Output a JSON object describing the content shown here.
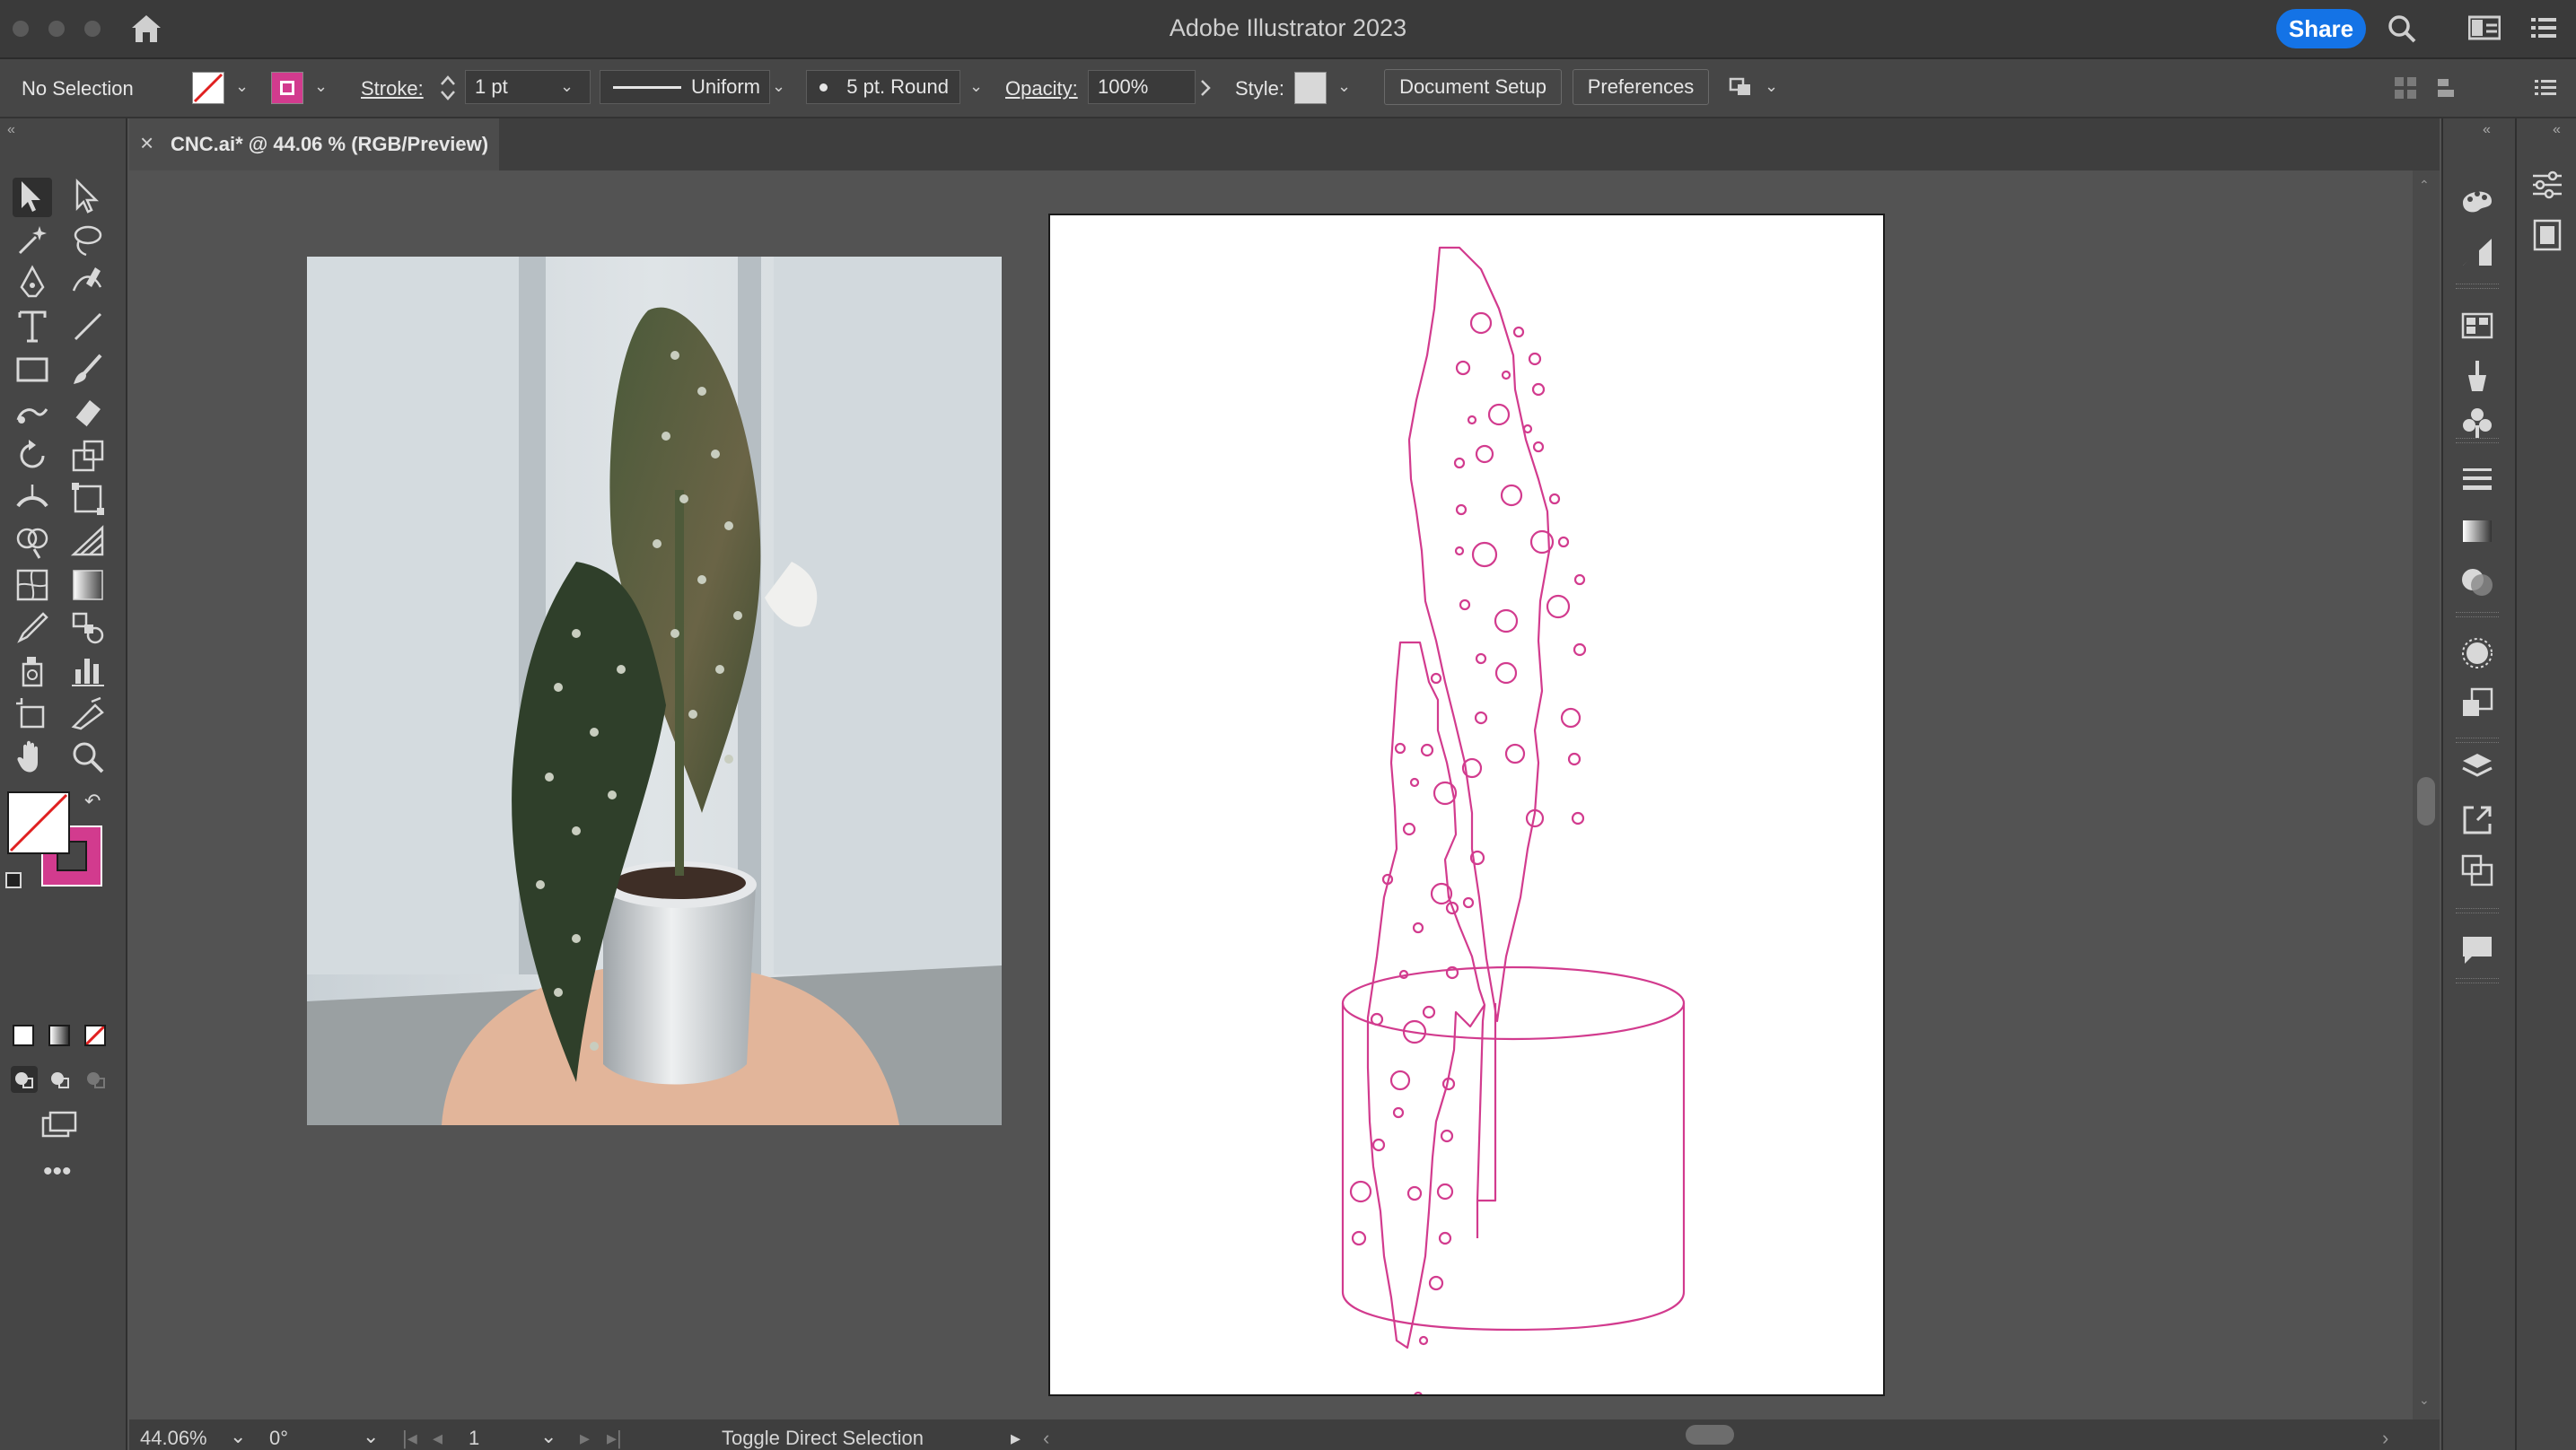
{
  "window": {
    "title": "Adobe Illustrator 2023",
    "share_label": "Share"
  },
  "control_bar": {
    "selection": "No Selection",
    "stroke_label": "Stroke:",
    "stroke_weight": "1 pt",
    "variable_width": "Uniform",
    "brush": "5 pt. Round",
    "opacity_label": "Opacity:",
    "opacity_value": "100%",
    "style_label": "Style:",
    "document_setup": "Document Setup",
    "preferences": "Preferences"
  },
  "document_tab": {
    "close": "×",
    "title": "CNC.ai* @ 44.06 % (RGB/Preview)"
  },
  "status_bar": {
    "zoom": "44.06%",
    "rotation": "0°",
    "artboard_number": "1",
    "tool_hint": "Toggle Direct Selection"
  },
  "colors": {
    "stroke_magenta": "#d23b8e",
    "accent_blue": "#1473e6",
    "panel_bg": "#464646",
    "canvas_bg": "#535353"
  },
  "tools": [
    "selection-tool",
    "direct-selection-tool",
    "magic-wand-tool",
    "lasso-tool",
    "pen-tool",
    "curvature-tool",
    "type-tool",
    "line-segment-tool",
    "rectangle-tool",
    "paintbrush-tool",
    "shaper-tool",
    "eraser-tool",
    "rotate-tool",
    "scale-tool",
    "width-tool",
    "free-transform-tool",
    "shape-builder-tool",
    "perspective-grid-tool",
    "mesh-tool",
    "gradient-tool",
    "eyedropper-tool",
    "blend-tool",
    "symbol-sprayer-tool",
    "column-graph-tool",
    "artboard-tool",
    "slice-tool",
    "hand-tool",
    "zoom-tool"
  ],
  "right_panels": [
    "color-panel-icon",
    "color-guide-icon",
    "swatches-icon",
    "brushes-icon",
    "symbols-icon",
    "stroke-icon",
    "gradient-icon",
    "transparency-icon",
    "appearance-icon",
    "graphic-styles-icon",
    "layers-icon",
    "export-icon",
    "artboards-icon",
    "comments-icon"
  ],
  "right_panels2": [
    "properties-icon",
    "libraries-icon"
  ]
}
